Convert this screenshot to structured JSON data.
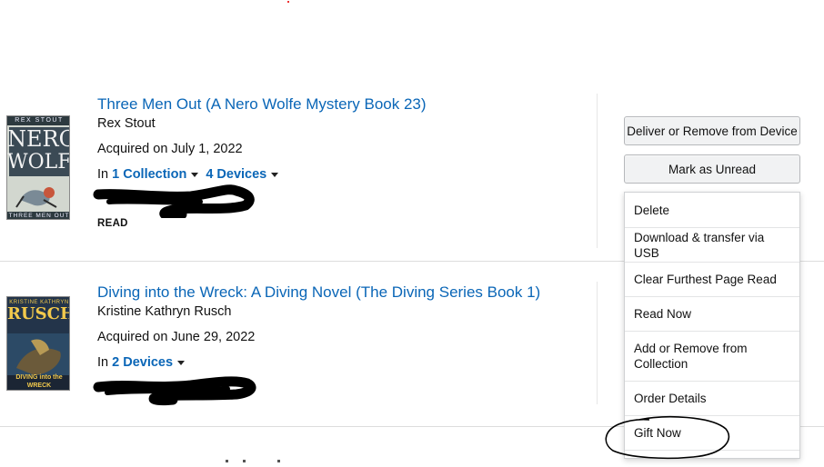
{
  "books": [
    {
      "title": "Three Men Out (A Nero Wolfe Mystery Book 23)",
      "author": "Rex Stout",
      "acquired": "Acquired on July 1, 2022",
      "in_label": "In",
      "collection_link": "1 Collection",
      "devices_link": "4 Devices",
      "status": "READ",
      "cover": {
        "top_text": "REX STOUT",
        "line1": "NERO",
        "line2": "WOLFE",
        "bottom_text": "THREE MEN OUT"
      }
    },
    {
      "title": "Diving into the Wreck: A Diving Novel (The Diving Series Book 1)",
      "author": "Kristine Kathryn Rusch",
      "acquired": "Acquired on June 29, 2022",
      "in_label": "In",
      "devices_link": "2 Devices",
      "cover": {
        "top_text": "KRISTINE KATHRYN",
        "line1": "RUSCH",
        "bottom_text": "DIVING into the WRECK"
      }
    }
  ],
  "actions": {
    "deliver_button": "Deliver or Remove from Device",
    "mark_unread_button": "Mark as Unread",
    "menu_items": [
      "Delete",
      "Download & transfer via USB",
      "Clear Furthest Page Read",
      "Read Now",
      "Add or Remove from Collection",
      "Order Details",
      "Gift Now"
    ]
  },
  "colors": {
    "link": "#0a66b7",
    "button_bg": "#f1f2f3",
    "annotation_ink": "#000000"
  }
}
